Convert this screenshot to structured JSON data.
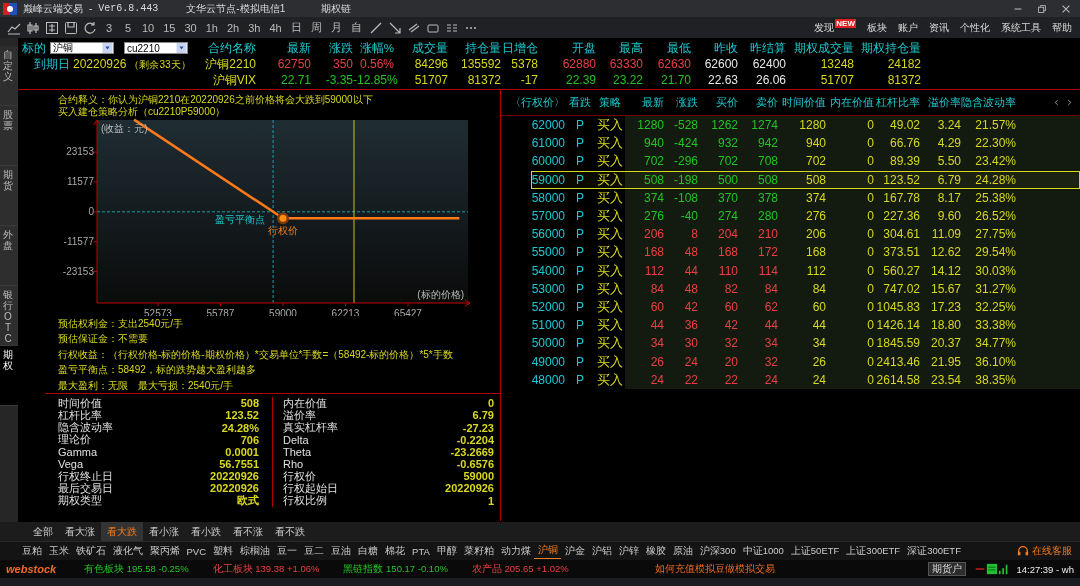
{
  "window": {
    "app_name": "巅峰云端交易",
    "separator": "-",
    "version": "Ver6.8.443",
    "server": "文华云节点-模拟电信1",
    "page": "期权链"
  },
  "toolbar": {
    "periods": [
      "3",
      "5",
      "10",
      "15",
      "30",
      "1h",
      "2h",
      "3h",
      "4h",
      "日",
      "周",
      "月",
      "自"
    ]
  },
  "menu": [
    {
      "label": "发现",
      "badge": "NEW"
    },
    {
      "label": "板块"
    },
    {
      "label": "账户"
    },
    {
      "label": "资讯"
    },
    {
      "label": "个性化"
    },
    {
      "label": "系统工具"
    },
    {
      "label": "帮助"
    }
  ],
  "side_tabs": [
    {
      "label": "自定义",
      "selected": false
    },
    {
      "label": "股票",
      "selected": false
    },
    {
      "label": "期货",
      "selected": false
    },
    {
      "label": "外盘",
      "selected": false
    },
    {
      "label": "银行OTC",
      "selected": false
    },
    {
      "label": "期权",
      "selected": true
    }
  ],
  "quote": {
    "underlying_label": "标的",
    "underlying": "沪铜",
    "contract": "cu2210",
    "expiry_label": "到期日",
    "expiry": "20220926",
    "remaining": "（剩余33天）",
    "columns": [
      {
        "label": "合约名称",
        "kind": "name"
      },
      {
        "label": "最新",
        "kind": "price"
      },
      {
        "label": "涨跌",
        "kind": "price"
      },
      {
        "label": "涨幅%",
        "kind": "price"
      },
      {
        "label": "成交量",
        "kind": "volume"
      },
      {
        "label": "持仓量",
        "kind": "volume"
      },
      {
        "label": "日增仓",
        "kind": "volume"
      },
      {
        "label": "开盘",
        "kind": "price"
      },
      {
        "label": "最高",
        "kind": "price"
      },
      {
        "label": "最低",
        "kind": "price"
      },
      {
        "label": "昨收",
        "kind": "ref"
      },
      {
        "label": "昨结算",
        "kind": "ref"
      },
      {
        "label": "期权成交量",
        "kind": "volume"
      },
      {
        "label": "期权持仓量",
        "kind": "volume"
      }
    ],
    "rows": [
      {
        "cells": [
          "沪铜2210",
          "62750",
          "350",
          "0.56%",
          "84296",
          "135592",
          "5378",
          "62880",
          "63330",
          "62630",
          "62600",
          "62400",
          "13248",
          "24182"
        ]
      },
      {
        "cells": [
          "沪铜VIX",
          "22.71",
          "-3.35",
          "-12.85%",
          "51707",
          "81372",
          "-17",
          "22.39",
          "23.22",
          "21.70",
          "22.63",
          "26.06",
          "51707",
          "81372"
        ]
      }
    ]
  },
  "strategy": {
    "description": "合约释义：你认为沪铜2210在20220926之前价格将会大跌到59000以下",
    "subtitle": "买入建仓策略分析（cu2210P59000）",
    "chart_data": {
      "type": "line",
      "xlabel": "(标的价格)",
      "ylabel": "(收益：元)",
      "x": [
        51400,
        59000,
        68000
      ],
      "series": [
        {
          "color": "#ff7a1a",
          "values": [
            35500,
            -2500,
            -2500
          ]
        }
      ],
      "xlim": [
        49440,
        68510
      ],
      "ylim": [
        -35370,
        35620
      ],
      "xticks": [
        52573,
        55787,
        59000,
        62213,
        65427
      ],
      "yticks": [
        -23153,
        -11577,
        0,
        11577,
        23153
      ],
      "ref_lines": [
        {
          "axis": "y",
          "value": 0,
          "color": "#1aa0a8"
        },
        {
          "axis": "x",
          "value": 58492,
          "color": "#1aa0a8"
        },
        {
          "axis": "x",
          "value": 62650,
          "color": "#c8c800"
        }
      ],
      "annotations": [
        {
          "text": "盈亏平衡点",
          "x": 58492,
          "y": 0
        },
        {
          "text": "行权价",
          "x": 59000,
          "y": -2500
        }
      ]
    },
    "notes": [
      "预估权利金：支出2540元/手",
      "预估保证金：不需要",
      "行权收益：（行权价格-标的价格-期权价格）*交易单位*手数=（58492-标的价格）*5*手数",
      "盈亏平衡点：58492，标的跌势越大盈利越多",
      "最大盈利：无限　最大亏损：2540元/手"
    ]
  },
  "stats": {
    "left": [
      {
        "label": "时间价值",
        "value": "508"
      },
      {
        "label": "杠杆比率",
        "value": "123.52"
      },
      {
        "label": "隐含波动率",
        "value": "24.28%"
      },
      {
        "label": "理论价",
        "value": "706"
      },
      {
        "label": "Gamma",
        "value": "0.0001"
      },
      {
        "label": "Vega",
        "value": "56.7551"
      },
      {
        "label": "行权终止日",
        "value": "20220926"
      },
      {
        "label": "最后交易日",
        "value": "20220926"
      },
      {
        "label": "期权类型",
        "value": "欧式"
      }
    ],
    "right": [
      {
        "label": "内在价值",
        "value": "0"
      },
      {
        "label": "溢价率",
        "value": "6.79"
      },
      {
        "label": "真实杠杆率",
        "value": "-27.23"
      },
      {
        "label": "Delta",
        "value": "-0.2204"
      },
      {
        "label": "Theta",
        "value": "-23.2669"
      },
      {
        "label": "Rho",
        "value": "-0.6576"
      },
      {
        "label": "行权价",
        "value": "59000"
      },
      {
        "label": "行权起始日",
        "value": "20220926"
      },
      {
        "label": "行权比例",
        "value": "1"
      }
    ]
  },
  "chain": {
    "columns": [
      {
        "label": "〈行权价〉",
        "kind": "strike"
      },
      {
        "label": "看跌",
        "kind": "type"
      },
      {
        "label": "策略",
        "kind": "action"
      },
      {
        "label": "最新",
        "kind": "price"
      },
      {
        "label": "涨跌",
        "kind": "price"
      },
      {
        "label": "买价",
        "kind": "price"
      },
      {
        "label": "卖价",
        "kind": "price"
      },
      {
        "label": "时间价值",
        "kind": "value"
      },
      {
        "label": "内在价值",
        "kind": "value"
      },
      {
        "label": "杠杆比率",
        "kind": "value"
      },
      {
        "label": "溢价率",
        "kind": "value"
      },
      {
        "label": "隐含波动率",
        "kind": "value"
      }
    ],
    "rows": [
      {
        "selected": false,
        "cells": [
          "62000",
          "P",
          "买入",
          "1280",
          "-528",
          "1262",
          "1274",
          "1280",
          "0",
          "49.02",
          "3.24",
          "21.57%"
        ]
      },
      {
        "selected": false,
        "cells": [
          "61000",
          "P",
          "买入",
          "940",
          "-424",
          "932",
          "942",
          "940",
          "0",
          "66.76",
          "4.29",
          "22.30%"
        ]
      },
      {
        "selected": false,
        "cells": [
          "60000",
          "P",
          "买入",
          "702",
          "-296",
          "702",
          "708",
          "702",
          "0",
          "89.39",
          "5.50",
          "23.42%"
        ]
      },
      {
        "selected": true,
        "cells": [
          "59000",
          "P",
          "买入",
          "508",
          "-198",
          "500",
          "508",
          "508",
          "0",
          "123.52",
          "6.79",
          "24.28%"
        ]
      },
      {
        "selected": false,
        "cells": [
          "58000",
          "P",
          "买入",
          "374",
          "-108",
          "370",
          "378",
          "374",
          "0",
          "167.78",
          "8.17",
          "25.38%"
        ]
      },
      {
        "selected": false,
        "cells": [
          "57000",
          "P",
          "买入",
          "276",
          "-40",
          "274",
          "280",
          "276",
          "0",
          "227.36",
          "9.60",
          "26.52%"
        ]
      },
      {
        "selected": false,
        "cells": [
          "56000",
          "P",
          "买入",
          "206",
          "8",
          "204",
          "210",
          "206",
          "0",
          "304.61",
          "11.09",
          "27.75%"
        ]
      },
      {
        "selected": false,
        "cells": [
          "55000",
          "P",
          "买入",
          "168",
          "48",
          "168",
          "172",
          "168",
          "0",
          "373.51",
          "12.62",
          "29.54%"
        ]
      },
      {
        "selected": false,
        "cells": [
          "54000",
          "P",
          "买入",
          "112",
          "44",
          "110",
          "114",
          "112",
          "0",
          "560.27",
          "14.12",
          "30.03%"
        ]
      },
      {
        "selected": false,
        "cells": [
          "53000",
          "P",
          "买入",
          "84",
          "48",
          "82",
          "84",
          "84",
          "0",
          "747.02",
          "15.67",
          "31.27%"
        ]
      },
      {
        "selected": false,
        "cells": [
          "52000",
          "P",
          "买入",
          "60",
          "42",
          "60",
          "62",
          "60",
          "0",
          "1045.83",
          "17.23",
          "32.25%"
        ]
      },
      {
        "selected": false,
        "cells": [
          "51000",
          "P",
          "买入",
          "44",
          "36",
          "42",
          "44",
          "44",
          "0",
          "1426.14",
          "18.80",
          "33.38%"
        ]
      },
      {
        "selected": false,
        "cells": [
          "50000",
          "P",
          "买入",
          "34",
          "30",
          "32",
          "34",
          "34",
          "0",
          "1845.59",
          "20.37",
          "34.77%"
        ]
      },
      {
        "selected": false,
        "cells": [
          "49000",
          "P",
          "买入",
          "26",
          "24",
          "20",
          "32",
          "26",
          "0",
          "2413.46",
          "21.95",
          "36.10%"
        ]
      },
      {
        "selected": false,
        "cells": [
          "48000",
          "P",
          "买入",
          "24",
          "22",
          "22",
          "24",
          "24",
          "0",
          "2614.58",
          "23.54",
          "38.35%"
        ]
      }
    ]
  },
  "filters": [
    {
      "label": "全部",
      "selected": false
    },
    {
      "label": "看大涨",
      "selected": false
    },
    {
      "label": "看大跌",
      "selected": true
    },
    {
      "label": "看小涨",
      "selected": false
    },
    {
      "label": "看小跌",
      "selected": false
    },
    {
      "label": "看不涨",
      "selected": false
    },
    {
      "label": "看不跌",
      "selected": false
    }
  ],
  "commodities": [
    {
      "label": "豆粕",
      "selected": false
    },
    {
      "label": "玉米",
      "selected": false
    },
    {
      "label": "铁矿石",
      "selected": false
    },
    {
      "label": "液化气",
      "selected": false
    },
    {
      "label": "聚丙烯",
      "selected": false
    },
    {
      "label": "PVC",
      "selected": false
    },
    {
      "label": "塑料",
      "selected": false
    },
    {
      "label": "棕榈油",
      "selected": false
    },
    {
      "label": "豆一",
      "selected": false
    },
    {
      "label": "豆二",
      "selected": false
    },
    {
      "label": "豆油",
      "selected": false
    },
    {
      "label": "白糖",
      "selected": false
    },
    {
      "label": "棉花",
      "selected": false
    },
    {
      "label": "PTA",
      "selected": false
    },
    {
      "label": "甲醇",
      "selected": false
    },
    {
      "label": "菜籽粕",
      "selected": false
    },
    {
      "label": "动力煤",
      "selected": false
    },
    {
      "label": "沪铜",
      "selected": true
    },
    {
      "label": "沪金",
      "selected": false
    },
    {
      "label": "沪铝",
      "selected": false
    },
    {
      "label": "沪锌",
      "selected": false
    },
    {
      "label": "橡胶",
      "selected": false
    },
    {
      "label": "原油",
      "selected": false
    },
    {
      "label": "沪深300",
      "selected": false
    },
    {
      "label": "中证1000",
      "selected": false
    },
    {
      "label": "上证50ETF",
      "selected": false
    },
    {
      "label": "上证300ETF",
      "selected": false
    },
    {
      "label": "深证300ETF",
      "selected": false
    }
  ],
  "support": "在线客服",
  "status": {
    "brand": "webstock",
    "indices": [
      {
        "name": "有色板块",
        "value": "195.58",
        "change": "-0.25%"
      },
      {
        "name": "化工板块",
        "value": "139.38",
        "change": "+1.06%"
      },
      {
        "name": "黑链指数",
        "value": "150.17",
        "change": "-0.10%"
      },
      {
        "name": "农产品",
        "value": "205.65",
        "change": "+1.02%"
      }
    ],
    "promo": "如何充值模拟豆做模拟交易",
    "account": "期货户",
    "time": "14:27:39 - wh"
  }
}
